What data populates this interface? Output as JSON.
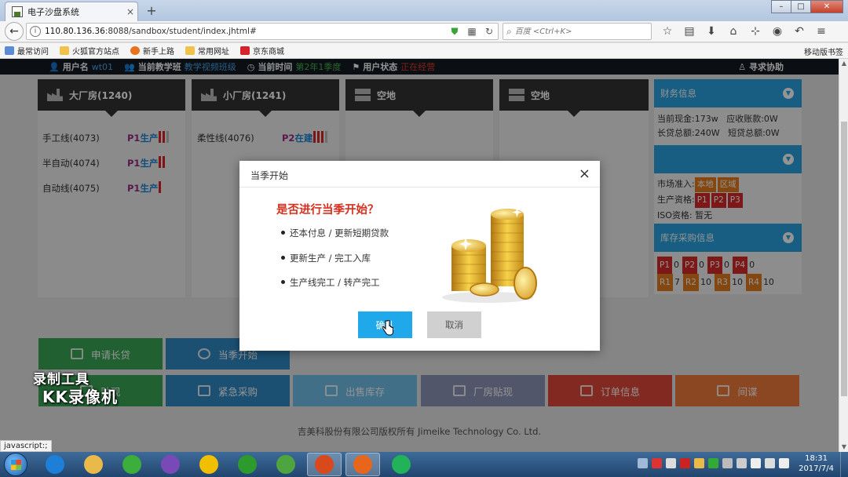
{
  "browser": {
    "tab_title": "电子沙盘系统",
    "tab_close": "×",
    "new_tab": "+",
    "url_host": "110.80.136.36",
    "url_rest": ":8088/sandbox/student/index.jhtml#",
    "search_placeholder": "百度 <Ctrl+K>",
    "window_controls": [
      "–",
      "□",
      "✕"
    ]
  },
  "bookmarks": [
    {
      "label": "最常访问",
      "color": "#5b8bd6"
    },
    {
      "label": "火狐官方站点",
      "color": "#f0c24b"
    },
    {
      "label": "新手上路",
      "color": "#e8731f"
    },
    {
      "label": "常用网址",
      "color": "#f0c24b"
    },
    {
      "label": "京东商城",
      "color": "#d4232c"
    }
  ],
  "bookmarks_mobile": "移动版书签",
  "appbar": {
    "user_label": "用户名",
    "user_value": "wt01",
    "class_label": "当前教学班",
    "class_value": "教学视频班级",
    "time_label": "当前时间",
    "time_value": "第2年1季度",
    "status_label": "用户状态",
    "status_value": "正在经营",
    "help": "寻求协助"
  },
  "panels": [
    {
      "title": "大厂房(1240)",
      "icon": "factory-icon"
    },
    {
      "title": "小厂房(1241)",
      "icon": "factory-icon"
    },
    {
      "title": "空地",
      "icon": "grid-icon"
    },
    {
      "title": "空地",
      "icon": "grid-icon"
    }
  ],
  "big_factory_lines": [
    {
      "name": "手工线(4073)",
      "product": "P1",
      "state": "生产",
      "bars": 2,
      "grey": 1
    },
    {
      "name": "半自动(4074)",
      "product": "P1",
      "state": "生产",
      "bars": 2,
      "grey": 0
    },
    {
      "name": "自动线(4075)",
      "product": "P1",
      "state": "生产",
      "bars": 1,
      "grey": 0
    }
  ],
  "small_factory_lines": [
    {
      "name": "柔性线(4076)",
      "product": "P2",
      "state": "在建",
      "bars": 3,
      "grey": 1
    }
  ],
  "sidebar": {
    "finance_title": "财务信息",
    "cash": "当前现金:173w",
    "receivable": "应收账款:0W",
    "long_loan": "长贷总额:240W",
    "short_loan": "短贷总额:0W",
    "market_label": "市场准入:",
    "markets": [
      "本地",
      "区域"
    ],
    "production_label": "生产资格:",
    "productions": [
      "P1",
      "P2",
      "P3"
    ],
    "iso": "ISO资格: 暂无",
    "inventory_title": "库存采购信息",
    "products": [
      {
        "k": "P1",
        "v": "0"
      },
      {
        "k": "P2",
        "v": "0"
      },
      {
        "k": "P3",
        "v": "0"
      },
      {
        "k": "P4",
        "v": "0"
      }
    ],
    "materials": [
      {
        "k": "R1",
        "v": "7"
      },
      {
        "k": "R2",
        "v": "10"
      },
      {
        "k": "R3",
        "v": "10"
      },
      {
        "k": "R4",
        "v": "10"
      }
    ]
  },
  "action_buttons_row1": [
    {
      "label": "申请长贷",
      "color": "#3aa655"
    },
    {
      "label": "当季开始",
      "color": "#2f8bc7"
    }
  ],
  "action_buttons_row2": [
    {
      "label": "贴现",
      "color": "#3aa655"
    },
    {
      "label": "紧急采购",
      "color": "#2f8bc7"
    },
    {
      "label": "出售库存",
      "color": "#6fc0e8"
    },
    {
      "label": "厂房贴现",
      "color": "#8e94b8"
    },
    {
      "label": "订单信息",
      "color": "#e0473a"
    },
    {
      "label": "间谍",
      "color": "#f07a3a"
    }
  ],
  "footer": "吉美科股份有限公司版权所有 Jimeike Technology Co. Ltd.",
  "dialog": {
    "title": "当季开始",
    "close": "×",
    "question": "是否进行当季开始？",
    "items": [
      "还本付息 / 更新短期贷款",
      "更新生产 / 完工入库",
      "生产线完工 / 转产完工"
    ],
    "ok": "确认",
    "cancel": "取消"
  },
  "watermark": {
    "line1": "录制工具",
    "line2": "KK录像机"
  },
  "status_tip": "javascript:;",
  "taskbar": {
    "time": "18:31",
    "date": "2017/7/4",
    "apps": [
      "#1e7fd8",
      "#e9b949",
      "#3cae3c",
      "#7a49b8",
      "#f0c000",
      "#2c9a2c",
      "#4ea540",
      "#d84a1c",
      "#e8661c",
      "#21b25a"
    ]
  }
}
